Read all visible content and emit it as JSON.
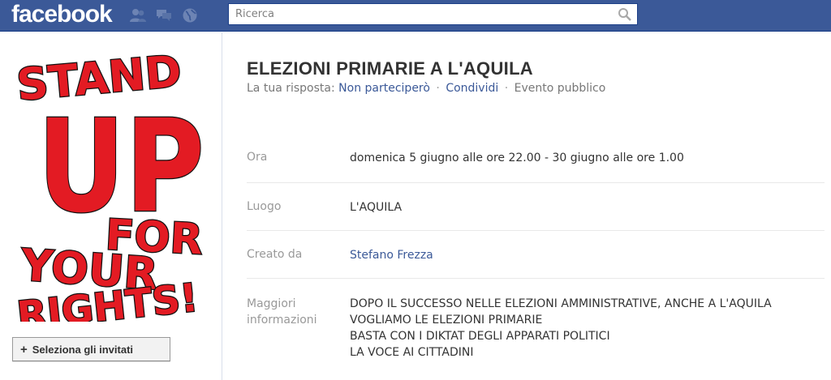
{
  "header": {
    "logo": "facebook",
    "search_placeholder": "Ricerca"
  },
  "icons": {
    "friends": "friends-icon",
    "messages": "messages-icon",
    "notifications": "globe-icon",
    "search": "search-icon"
  },
  "poster": {
    "lines": [
      "STAND",
      "UP",
      "FOR",
      "YOUR",
      "RIGHTS!"
    ],
    "color": "#e31b23"
  },
  "sidebar": {
    "invite_button": "Seleziona gli invitati",
    "invite_plus": "+"
  },
  "event": {
    "title": "ELEZIONI PRIMARIE A L'AQUILA",
    "response_label": "La tua risposta:",
    "response_value": "Non parteciperò",
    "share": "Condividi",
    "visibility": "Evento pubblico",
    "separator": "·"
  },
  "details": {
    "time_label": "Ora",
    "time_value": "domenica 5 giugno alle ore 22.00 - 30 giugno alle ore 1.00",
    "place_label": "Luogo",
    "place_value": "L'AQUILA",
    "creator_label": "Creato da",
    "creator_value": "Stefano Frezza",
    "more_label_1": "Maggiori",
    "more_label_2": "informazioni",
    "more_lines": [
      "DOPO IL SUCCESSO NELLE ELEZIONI AMMINISTRATIVE, ANCHE A L'AQUILA",
      "VOGLIAMO LE ELEZIONI PRIMARIE",
      "BASTA CON I DIKTAT DEGLI APPARATI POLITICI",
      "LA VOCE AI CITTADINI"
    ]
  },
  "colors": {
    "brand_blue": "#3b5998",
    "link_blue": "#3b5998"
  }
}
